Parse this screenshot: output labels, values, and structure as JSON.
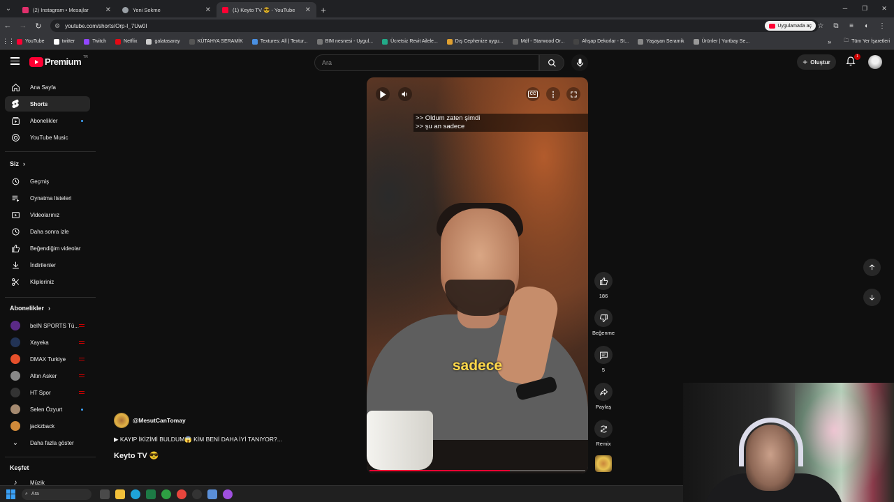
{
  "browser": {
    "tabs": [
      {
        "title": "(2) Instagram • Mesajlar",
        "favicon_color": "#e1306c",
        "active": false
      },
      {
        "title": "Yeni Sekme",
        "favicon_color": "#9aa0a6",
        "active": false
      },
      {
        "title": "(1) Keyto TV 😎 - YouTube",
        "favicon_color": "#ff0033",
        "active": true
      }
    ],
    "url": "youtube.com/shorts/Orp-I_7Uw0I",
    "open_in_app": "Uygulamada aç",
    "bookmarks": [
      {
        "label": "YouTube",
        "color": "#ff0033"
      },
      {
        "label": "twitter",
        "color": "#ffffff"
      },
      {
        "label": "Twitch",
        "color": "#9146ff"
      },
      {
        "label": "Netflix",
        "color": "#e50914"
      },
      {
        "label": "galatasaray",
        "color": "#cccccc"
      },
      {
        "label": "KÜTAHYA SERAMİK",
        "color": "#555555"
      },
      {
        "label": "Textures: All | Textur...",
        "color": "#4a90e2"
      },
      {
        "label": "BIM nesnesi - Uygul...",
        "color": "#777777"
      },
      {
        "label": "Ücretsiz Revit Ailele...",
        "color": "#22aa88"
      },
      {
        "label": "Dış Cephenize uygu...",
        "color": "#e0a030"
      },
      {
        "label": "Mdf - Starwood Or...",
        "color": "#666666"
      },
      {
        "label": "Ahşap Dekorlar - St...",
        "color": "#444444"
      },
      {
        "label": "Yaşayan Seramik",
        "color": "#888888"
      },
      {
        "label": "Ürünler | Yurtbay Se...",
        "color": "#999999"
      }
    ],
    "all_bookmarks": "Tüm Yer İşaretleri"
  },
  "yt_header": {
    "logo_text": "Premium",
    "country_code": "TR",
    "search_placeholder": "Ara",
    "create_label": "Oluştur",
    "notification_count": "1"
  },
  "sidebar": {
    "main": [
      {
        "label": "Ana Sayfa",
        "icon": "home-icon"
      },
      {
        "label": "Shorts",
        "icon": "shorts-icon",
        "active": true
      },
      {
        "label": "Abonelikler",
        "icon": "subscriptions-icon",
        "dot": true
      },
      {
        "label": "YouTube Music",
        "icon": "music-icon"
      }
    ],
    "you_heading": "Siz",
    "you": [
      {
        "label": "Geçmiş",
        "icon": "history-icon"
      },
      {
        "label": "Oynatma listeleri",
        "icon": "playlist-icon"
      },
      {
        "label": "Videolarınız",
        "icon": "your-videos-icon"
      },
      {
        "label": "Daha sonra izle",
        "icon": "watch-later-icon"
      },
      {
        "label": "Beğendiğim videolar",
        "icon": "liked-icon"
      },
      {
        "label": "İndirilenler",
        "icon": "download-icon"
      },
      {
        "label": "Klipleriniz",
        "icon": "clips-icon"
      }
    ],
    "subs_heading": "Abonelikler",
    "subscriptions": [
      {
        "label": "beIN SPORTS Tü...",
        "color": "#5b2a86",
        "live": true
      },
      {
        "label": "Xayeka",
        "color": "#223355",
        "live": true
      },
      {
        "label": "DMAX Turkiye",
        "color": "#e6502b",
        "live": true
      },
      {
        "label": "Altın Asker",
        "color": "#888888",
        "live": true
      },
      {
        "label": "HT Spor",
        "color": "#333333",
        "live": true
      },
      {
        "label": "Selen Özyurt",
        "color": "#a58a70",
        "dot": true
      },
      {
        "label": "jackzback",
        "color": "#d08a3a"
      }
    ],
    "show_more": "Daha fazla göster",
    "explore_heading": "Keşfet",
    "explore_first": "Müzik"
  },
  "short": {
    "subtitle_line1": ">> Oldum zaten şimdi",
    "subtitle_line2": ">> şu an sadece",
    "caption": "sadece",
    "progress": 0.65,
    "likes": "186",
    "dislike_label": "Beğenme",
    "comments": "5",
    "share_label": "Paylaş",
    "remix_label": "Remix",
    "channel_handle": "@MesutCanTomay",
    "video_title": "▶ KAYIP İKİZİMİ BULDUM😱 KİM BENİ DAHA İYİ TANIYOR?...",
    "channel_name": "Keyto TV 😎"
  },
  "taskbar": {
    "search_placeholder": "Ara",
    "apps": [
      {
        "name": "task-view",
        "color": "#4a4a4a"
      },
      {
        "name": "file-explorer",
        "color": "#f3c13a"
      },
      {
        "name": "edge",
        "color": "#1fa3d8"
      },
      {
        "name": "excel",
        "color": "#1d7a45"
      },
      {
        "name": "xbox",
        "color": "#2ea043"
      },
      {
        "name": "chrome",
        "color": "#e8453c"
      },
      {
        "name": "obs",
        "color": "#333333"
      },
      {
        "name": "settings",
        "color": "#5a8fd8"
      },
      {
        "name": "messenger",
        "color": "#a050e0"
      }
    ]
  }
}
